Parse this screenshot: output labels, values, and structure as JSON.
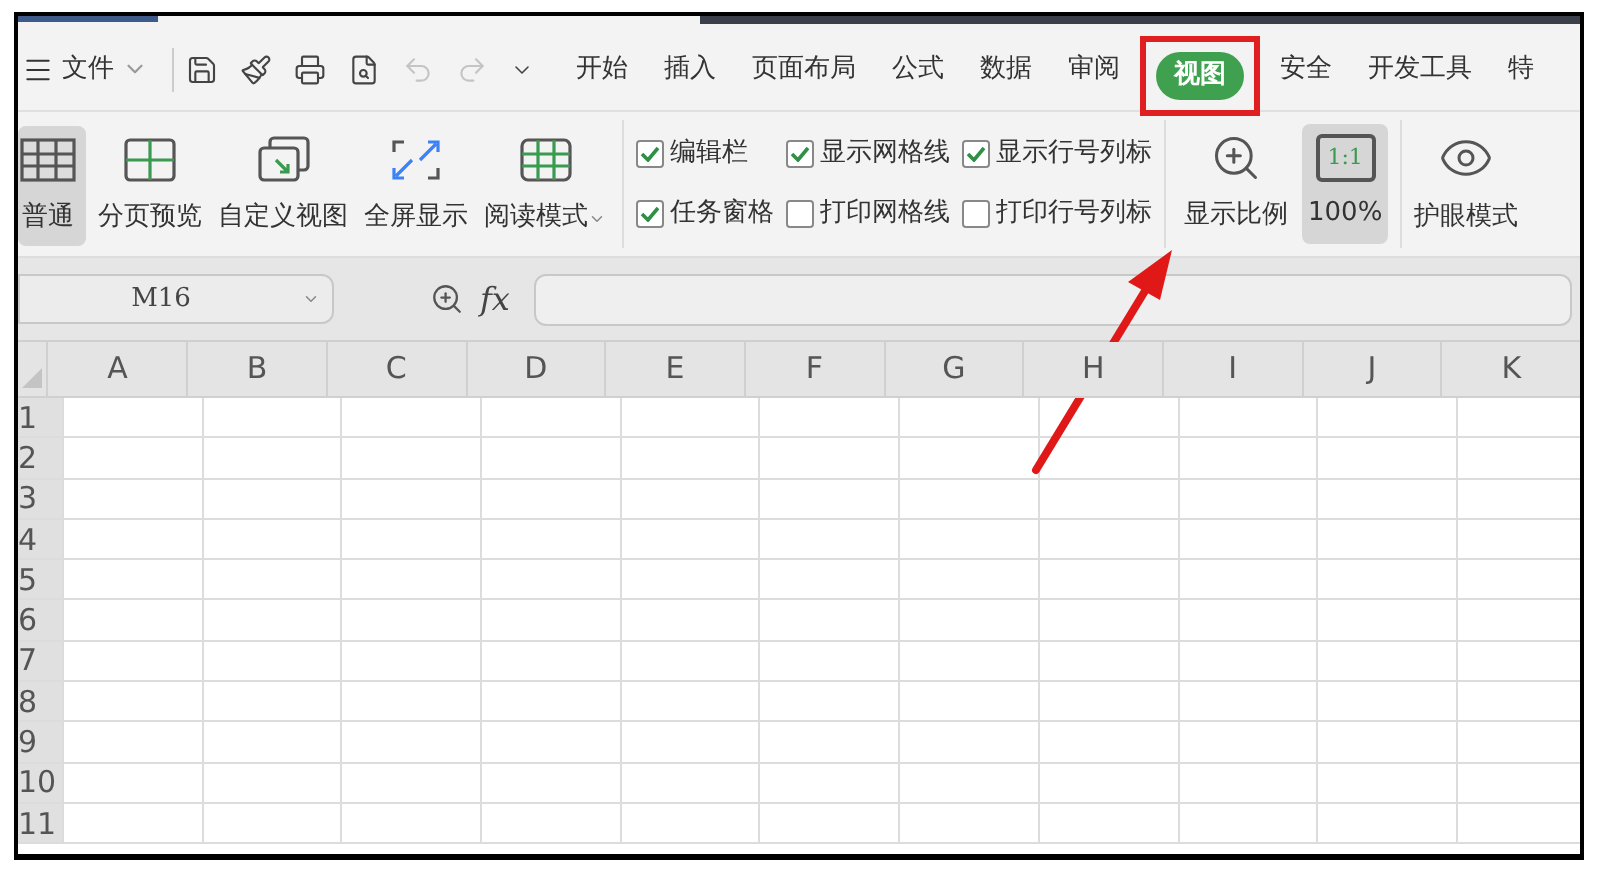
{
  "menu": {
    "file_label": "文件",
    "quick_tools": [
      {
        "kind": "save",
        "disabled": false
      },
      {
        "kind": "painter",
        "disabled": false
      },
      {
        "kind": "print",
        "disabled": false
      },
      {
        "kind": "preview",
        "disabled": false
      },
      {
        "kind": "undo",
        "disabled": true
      },
      {
        "kind": "redo",
        "disabled": true
      },
      {
        "kind": "more",
        "disabled": false
      }
    ],
    "tabs": [
      {
        "label": "开始",
        "selected": false,
        "highlighted": false
      },
      {
        "label": "插入",
        "selected": false,
        "highlighted": false
      },
      {
        "label": "页面布局",
        "selected": false,
        "highlighted": false
      },
      {
        "label": "公式",
        "selected": false,
        "highlighted": false
      },
      {
        "label": "数据",
        "selected": false,
        "highlighted": false
      },
      {
        "label": "审阅",
        "selected": false,
        "highlighted": false
      },
      {
        "label": "视图",
        "selected": true,
        "highlighted": true
      },
      {
        "label": "安全",
        "selected": false,
        "highlighted": false
      },
      {
        "label": "开发工具",
        "selected": false,
        "highlighted": false
      },
      {
        "label": "特",
        "selected": false,
        "highlighted": false
      }
    ]
  },
  "ribbon": {
    "view_modes": [
      {
        "label": "普通",
        "kind": "normal",
        "selected": true,
        "dropdown": false
      },
      {
        "label": "分页预览",
        "kind": "page_break",
        "selected": false,
        "dropdown": false
      },
      {
        "label": "自定义视图",
        "kind": "custom",
        "selected": false,
        "dropdown": false
      },
      {
        "label": "全屏显示",
        "kind": "fullscreen",
        "selected": false,
        "dropdown": false
      },
      {
        "label": "阅读模式",
        "kind": "reading",
        "selected": false,
        "dropdown": true
      }
    ],
    "checkbox_columns": [
      [
        {
          "label": "编辑栏",
          "checked": true
        },
        {
          "label": "任务窗格",
          "checked": true
        }
      ],
      [
        {
          "label": "显示网格线",
          "checked": true
        },
        {
          "label": "打印网格线",
          "checked": false
        }
      ],
      [
        {
          "label": "显示行号列标",
          "checked": true
        },
        {
          "label": "打印行号列标",
          "checked": false
        }
      ]
    ],
    "zoom_tools": [
      {
        "label": "显示比例",
        "kind": "zoom",
        "selected": false
      },
      {
        "label": "100%",
        "kind": "actual",
        "selected": true,
        "icon_text": "1:1"
      }
    ],
    "eye_tool": {
      "label": "护眼模式",
      "selected": false
    }
  },
  "formula_bar": {
    "name_box": "M16",
    "fx": "fx"
  },
  "grid": {
    "columns": [
      "A",
      "B",
      "C",
      "D",
      "E",
      "F",
      "G",
      "H",
      "I",
      "J",
      "K"
    ],
    "rows": [
      "1",
      "2",
      "3",
      "4",
      "5",
      "6",
      "7",
      "8",
      "9",
      "10",
      "11"
    ]
  }
}
